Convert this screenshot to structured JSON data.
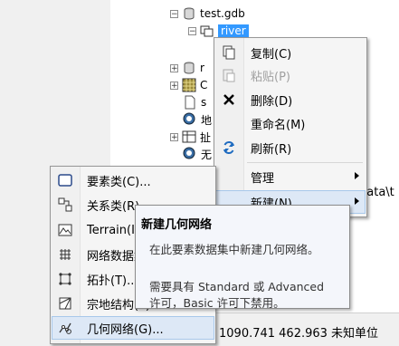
{
  "tree": {
    "gdb_label": "test.gdb",
    "river_label": "river",
    "partial_c": "C",
    "partial_s": "s",
    "partial_r": "r",
    "partial_g1": "地",
    "partial_g2": "扯",
    "partial_g3": "无"
  },
  "context_menu": {
    "items": [
      {
        "label": "复制(C)",
        "icon": "copy-icon"
      },
      {
        "label": "粘贴(P)",
        "icon": "paste-icon",
        "disabled": true
      },
      {
        "label": "删除(D)",
        "icon": "delete-icon"
      },
      {
        "label": "重命名(M)",
        "icon": ""
      },
      {
        "label": "刷新(R)",
        "icon": "refresh-icon"
      },
      {
        "label": "管理",
        "icon": "",
        "submenu": true
      },
      {
        "label": "新建(N)",
        "icon": "",
        "submenu": true
      }
    ]
  },
  "new_submenu": {
    "items": [
      {
        "label": "要素类(C)...",
        "icon": "feature-class-icon"
      },
      {
        "label": "关系类(R)...",
        "icon": "relationship-class-icon"
      },
      {
        "label": "Terrain(I)...",
        "icon": "terrain-icon"
      },
      {
        "label": "网络数据集(N)...",
        "icon": "network-dataset-icon"
      },
      {
        "label": "拓扑(T)...",
        "icon": "topology-icon"
      },
      {
        "label": "宗地结构(P)...",
        "icon": "parcel-fabric-icon"
      },
      {
        "label": "几何网络(G)...",
        "icon": "geometric-network-icon"
      }
    ]
  },
  "tooltip": {
    "title": "新建几何网络",
    "line1": "在此要素数据集中新建几何网络。",
    "line2": "需要具有 Standard 或 Advanced",
    "line3": "许可，Basic 许可下禁用。"
  },
  "status_bar": {
    "coords": "1090.741  462.963 未知单位"
  },
  "background_path": "data\\t"
}
